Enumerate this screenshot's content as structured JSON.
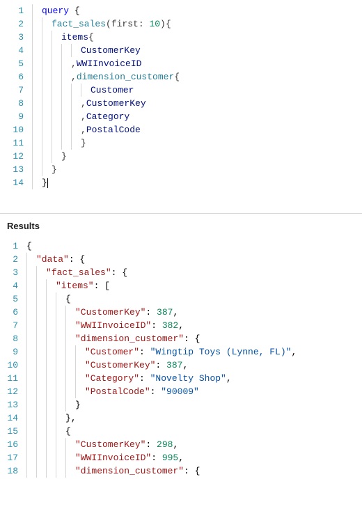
{
  "results_heading": "Results",
  "query_lines": [
    {
      "n": 1,
      "guides": 1,
      "segments": [
        [
          "kw",
          "query "
        ],
        [
          "brace",
          "{"
        ]
      ]
    },
    {
      "n": 2,
      "guides": 2,
      "segments": [
        [
          "type",
          "fact_sales"
        ],
        [
          "punc",
          "(first: "
        ],
        [
          "num",
          "10"
        ],
        [
          "punc",
          "){"
        ]
      ]
    },
    {
      "n": 3,
      "guides": 3,
      "segments": [
        [
          "field",
          "items"
        ],
        [
          "punc",
          "{"
        ]
      ]
    },
    {
      "n": 4,
      "guides": 5,
      "segments": [
        [
          "field",
          "CustomerKey"
        ]
      ]
    },
    {
      "n": 5,
      "guides": 4,
      "segments": [
        [
          "punc",
          ","
        ],
        [
          "field",
          "WWIInvoiceID"
        ]
      ]
    },
    {
      "n": 6,
      "guides": 4,
      "segments": [
        [
          "punc",
          ","
        ],
        [
          "type",
          "dimension_customer"
        ],
        [
          "punc",
          "{"
        ]
      ]
    },
    {
      "n": 7,
      "guides": 6,
      "segments": [
        [
          "field",
          "Customer"
        ]
      ]
    },
    {
      "n": 8,
      "guides": 5,
      "segments": [
        [
          "punc",
          ","
        ],
        [
          "field",
          "CustomerKey"
        ]
      ]
    },
    {
      "n": 9,
      "guides": 5,
      "segments": [
        [
          "punc",
          ","
        ],
        [
          "field",
          "Category"
        ]
      ]
    },
    {
      "n": 10,
      "guides": 5,
      "segments": [
        [
          "punc",
          ","
        ],
        [
          "field",
          "PostalCode"
        ]
      ]
    },
    {
      "n": 11,
      "guides": 5,
      "segments": [
        [
          "punc",
          "}"
        ]
      ]
    },
    {
      "n": 12,
      "guides": 3,
      "segments": [
        [
          "punc",
          "}"
        ]
      ]
    },
    {
      "n": 13,
      "guides": 2,
      "segments": [
        [
          "punc",
          "}"
        ]
      ]
    },
    {
      "n": 14,
      "guides": 1,
      "cursor": true,
      "segments": [
        [
          "brace",
          "}"
        ]
      ]
    }
  ],
  "result_lines": [
    {
      "n": 1,
      "guides": 0,
      "segments": [
        [
          "jpunc",
          "{"
        ]
      ]
    },
    {
      "n": 2,
      "guides": 1,
      "segments": [
        [
          "jkey",
          "\"data\""
        ],
        [
          "jpunc",
          ": {"
        ]
      ]
    },
    {
      "n": 3,
      "guides": 2,
      "segments": [
        [
          "jkey",
          "\"fact_sales\""
        ],
        [
          "jpunc",
          ": {"
        ]
      ]
    },
    {
      "n": 4,
      "guides": 3,
      "segments": [
        [
          "jkey",
          "\"items\""
        ],
        [
          "jpunc",
          ": ["
        ]
      ]
    },
    {
      "n": 5,
      "guides": 4,
      "segments": [
        [
          "jpunc",
          "{"
        ]
      ]
    },
    {
      "n": 6,
      "guides": 5,
      "segments": [
        [
          "jkey",
          "\"CustomerKey\""
        ],
        [
          "jpunc",
          ": "
        ],
        [
          "jnum",
          "387"
        ],
        [
          "jpunc",
          ","
        ]
      ]
    },
    {
      "n": 7,
      "guides": 5,
      "segments": [
        [
          "jkey",
          "\"WWIInvoiceID\""
        ],
        [
          "jpunc",
          ": "
        ],
        [
          "jnum",
          "382"
        ],
        [
          "jpunc",
          ","
        ]
      ]
    },
    {
      "n": 8,
      "guides": 5,
      "segments": [
        [
          "jkey",
          "\"dimension_customer\""
        ],
        [
          "jpunc",
          ": {"
        ]
      ]
    },
    {
      "n": 9,
      "guides": 6,
      "segments": [
        [
          "jkey",
          "\"Customer\""
        ],
        [
          "jpunc",
          ": "
        ],
        [
          "jstr",
          "\"Wingtip Toys (Lynne, FL)\""
        ],
        [
          "jpunc",
          ","
        ]
      ]
    },
    {
      "n": 10,
      "guides": 6,
      "segments": [
        [
          "jkey",
          "\"CustomerKey\""
        ],
        [
          "jpunc",
          ": "
        ],
        [
          "jnum",
          "387"
        ],
        [
          "jpunc",
          ","
        ]
      ]
    },
    {
      "n": 11,
      "guides": 6,
      "segments": [
        [
          "jkey",
          "\"Category\""
        ],
        [
          "jpunc",
          ": "
        ],
        [
          "jstr",
          "\"Novelty Shop\""
        ],
        [
          "jpunc",
          ","
        ]
      ]
    },
    {
      "n": 12,
      "guides": 6,
      "segments": [
        [
          "jkey",
          "\"PostalCode\""
        ],
        [
          "jpunc",
          ": "
        ],
        [
          "jstr",
          "\"90009\""
        ]
      ]
    },
    {
      "n": 13,
      "guides": 5,
      "segments": [
        [
          "jpunc",
          "}"
        ]
      ]
    },
    {
      "n": 14,
      "guides": 4,
      "segments": [
        [
          "jpunc",
          "},"
        ]
      ]
    },
    {
      "n": 15,
      "guides": 4,
      "segments": [
        [
          "jpunc",
          "{"
        ]
      ]
    },
    {
      "n": 16,
      "guides": 5,
      "segments": [
        [
          "jkey",
          "\"CustomerKey\""
        ],
        [
          "jpunc",
          ": "
        ],
        [
          "jnum",
          "298"
        ],
        [
          "jpunc",
          ","
        ]
      ]
    },
    {
      "n": 17,
      "guides": 5,
      "segments": [
        [
          "jkey",
          "\"WWIInvoiceID\""
        ],
        [
          "jpunc",
          ": "
        ],
        [
          "jnum",
          "995"
        ],
        [
          "jpunc",
          ","
        ]
      ]
    },
    {
      "n": 18,
      "guides": 5,
      "segments": [
        [
          "jkey",
          "\"dimension_customer\""
        ],
        [
          "jpunc",
          ": {"
        ]
      ]
    }
  ],
  "chart_data": {
    "type": "table",
    "title": "fact_sales items",
    "columns": [
      "CustomerKey",
      "WWIInvoiceID",
      "dimension_customer.Customer",
      "dimension_customer.CustomerKey",
      "dimension_customer.Category",
      "dimension_customer.PostalCode"
    ],
    "rows": [
      [
        387,
        382,
        "Wingtip Toys (Lynne, FL)",
        387,
        "Novelty Shop",
        "90009"
      ],
      [
        298,
        995,
        null,
        null,
        null,
        null
      ]
    ]
  }
}
